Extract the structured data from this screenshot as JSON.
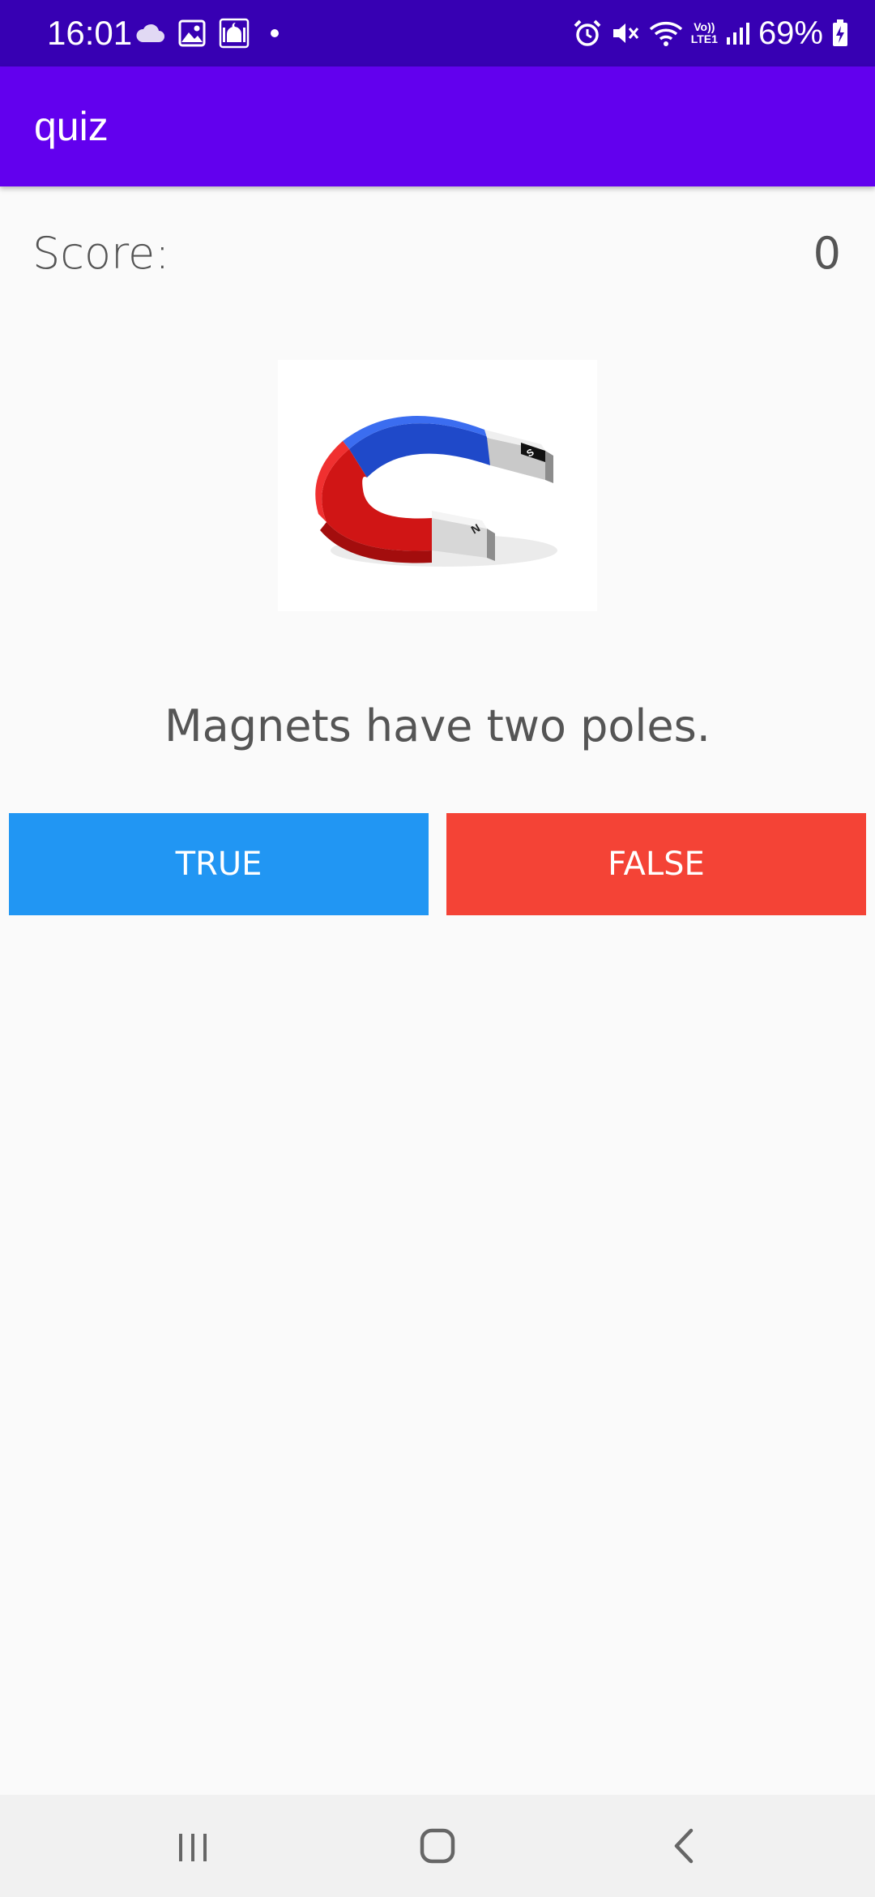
{
  "status_bar": {
    "time": "16:01",
    "battery_percent": "69%",
    "network_label_top": "Vo))",
    "network_label_bottom": "LTE1",
    "left_icons": [
      "cloud-icon",
      "image-icon",
      "mosque-icon",
      "dot-icon"
    ],
    "right_icons": [
      "alarm-icon",
      "vibrate-mute-icon",
      "wifi-icon",
      "volte-icon",
      "signal-icon",
      "battery-charging-icon"
    ]
  },
  "app_bar": {
    "title": "quiz",
    "color": "#6200ee"
  },
  "score": {
    "label": "Score:",
    "value": "0"
  },
  "question": {
    "image_icon": "horseshoe-magnet-icon",
    "text": "Magnets have two poles."
  },
  "buttons": {
    "true_label": "TRUE",
    "true_color": "#2196f3",
    "false_label": "FALSE",
    "false_color": "#f44336"
  },
  "nav_bar": {
    "icons": [
      "recent-apps-icon",
      "home-icon",
      "back-icon"
    ]
  }
}
